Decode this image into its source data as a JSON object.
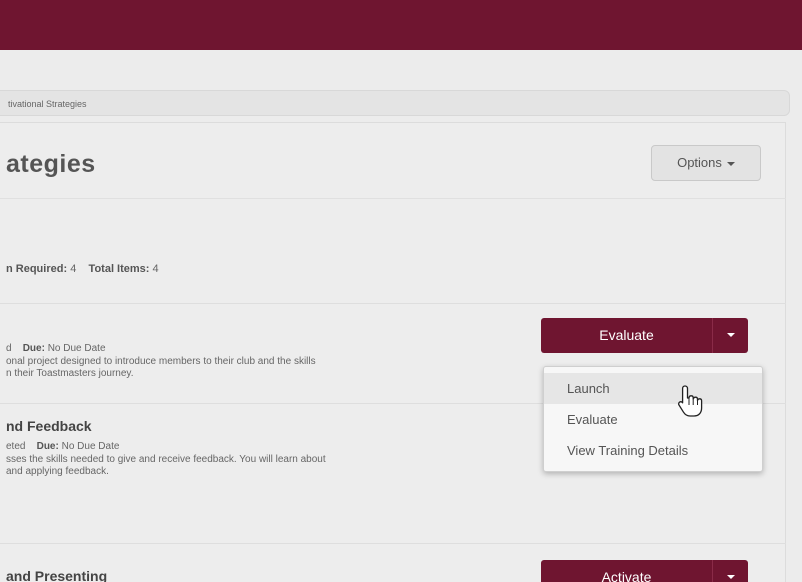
{
  "breadcrumb": {
    "text": "tivational Strategies"
  },
  "page": {
    "title": "ategies",
    "options_label": "Options"
  },
  "summary": {
    "required_label": "n Required:",
    "required_value": "4",
    "total_label": "Total Items:",
    "total_value": "4"
  },
  "items": [
    {
      "title": "",
      "status": "d",
      "due_label": "Due:",
      "due_value": "No Due Date",
      "desc_line1": "onal project designed to introduce members to their club and the skills",
      "desc_line2": "n their Toastmasters journey.",
      "action_label": "Evaluate"
    },
    {
      "title": "nd Feedback",
      "status": "eted",
      "due_label": "Due:",
      "due_value": "No Due Date",
      "desc_line1": "sses the skills needed to give and receive feedback. You will learn about",
      "desc_line2": "and applying feedback."
    },
    {
      "title": "and Presenting",
      "action_label": "Activate"
    }
  ],
  "dropdown": {
    "items": [
      "Launch",
      "Evaluate",
      "View Training Details"
    ]
  },
  "colors": {
    "brand": "#6f1530",
    "background": "#ececec"
  },
  "icons": {
    "caret": "caret-down-icon",
    "cursor": "hand-pointer-icon"
  }
}
